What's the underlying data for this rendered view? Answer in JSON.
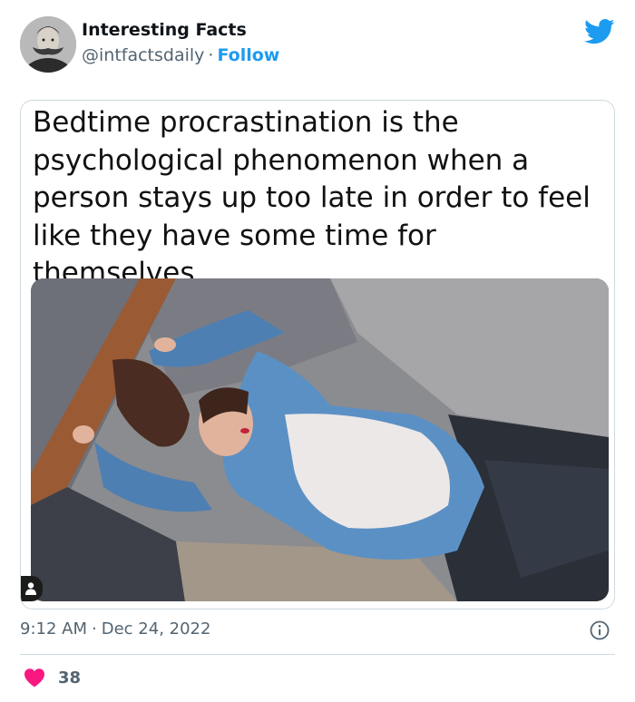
{
  "author": {
    "name": "Interesting Facts",
    "handle": "@intfactsdaily",
    "separator": "·",
    "follow_label": "Follow"
  },
  "brand_icon": "twitter-bird-icon",
  "card": {
    "text": "Bedtime procrastination is the psychological phenomenon when a person stays up too late in order to feel like they have some time for themselves."
  },
  "meta": {
    "time": "9:12 AM",
    "separator": "·",
    "date": "Dec 24, 2022"
  },
  "engagement": {
    "likes": "38"
  },
  "icons": {
    "avatar": "portrait-avatar",
    "like": "heart-icon",
    "info": "info-icon",
    "alt": "person-icon"
  },
  "colors": {
    "accent": "#1d9bf0",
    "like": "#f91880",
    "secondary_text": "#536471",
    "border": "#cfd9de"
  }
}
